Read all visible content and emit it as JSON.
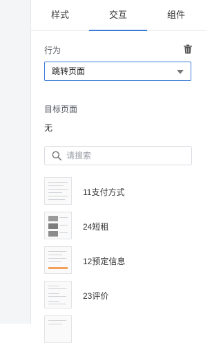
{
  "tabs": [
    {
      "label": "样式"
    },
    {
      "label": "交互",
      "active": true
    },
    {
      "label": "组件"
    }
  ],
  "interaction": {
    "behavior_label": "行为",
    "behavior_value": "跳转页面",
    "target_label": "目标页面",
    "target_value": "无"
  },
  "search": {
    "placeholder": "请搜索",
    "value": ""
  },
  "pages": [
    {
      "name": "11支付方式"
    },
    {
      "name": "24短租"
    },
    {
      "name": "12预定信息"
    },
    {
      "name": "23评价"
    },
    {
      "name": ""
    }
  ],
  "colors": {
    "accent": "#3a7bd5",
    "border": "#d8dbe0",
    "text": "#333333",
    "muted": "#9a9ea5"
  },
  "icons": {
    "delete": "trash-icon",
    "search": "search-icon",
    "dropdown": "chevron-down-icon"
  }
}
